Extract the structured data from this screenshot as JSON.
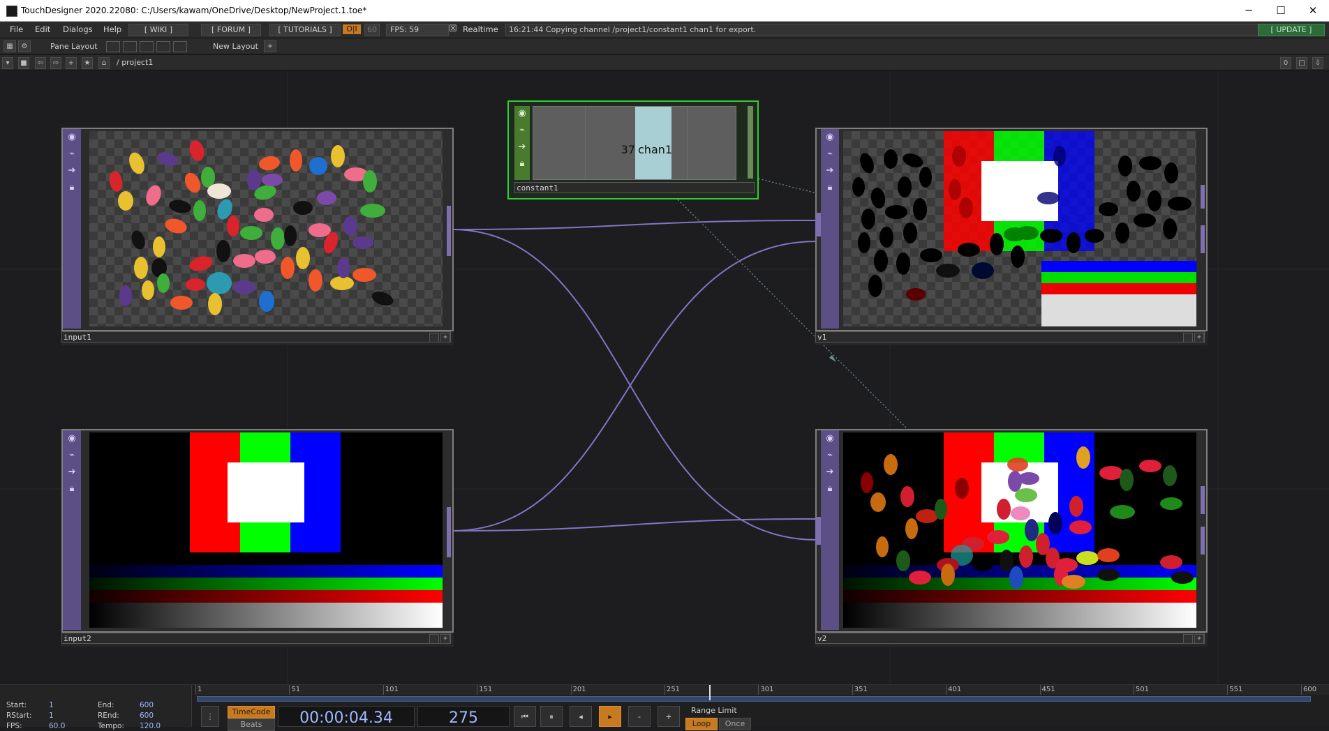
{
  "window": {
    "title": "TouchDesigner 2020.22080: C:/Users/kawam/OneDrive/Desktop/NewProject.1.toe*",
    "minimize": "─",
    "maximize": "☐",
    "close": "✕"
  },
  "menubar": {
    "items": [
      "File",
      "Edit",
      "Dialogs",
      "Help"
    ],
    "wiki": "[ WIKI ]",
    "forum": "[ FORUM ]",
    "tutorials": "[ TUTORIALS ]",
    "oi": "O|I",
    "fps_cap": "60",
    "fps": "FPS:  59",
    "realtime_check": "☒",
    "realtime": "Realtime",
    "status": "16:21:44 Copying channel /project1/constant1 chan1 for export.",
    "update": "[ UPDATE ]"
  },
  "layoutbar": {
    "pane_layout": "Pane Layout",
    "new_layout": "New Layout",
    "add": "+"
  },
  "pathbar": {
    "path": "/  project1",
    "zero": "0"
  },
  "nodes": {
    "input1": {
      "name": "input1"
    },
    "input2": {
      "name": "input2"
    },
    "v1": {
      "name": "v1"
    },
    "v2": {
      "name": "v2"
    },
    "constant1": {
      "name": "constant1",
      "value": "37",
      "channel": "chan1"
    }
  },
  "timeline": {
    "ticks": [
      "1",
      "51",
      "101",
      "151",
      "201",
      "251",
      "301",
      "351",
      "401",
      "451",
      "501",
      "551",
      "600"
    ],
    "start_label": "Start:",
    "start": "1",
    "end_label": "End:",
    "end": "600",
    "rstart_label": "RStart:",
    "rstart": "1",
    "rend_label": "REnd:",
    "rend": "600",
    "fps_label": "FPS:",
    "fps": "60.0",
    "tempo_label": "Tempo:",
    "tempo": "120.0",
    "timecode_btn": "TimeCode",
    "beats_btn": "Beats",
    "timecode": "00:00:04.34",
    "frame": "275",
    "range_limit": "Range Limit",
    "loop": "Loop",
    "once": "Once",
    "playhead_frame": 275
  },
  "colors": {
    "accent_orange": "#c87a20",
    "node_purple": "#5c4f86",
    "wire": "#8474c4",
    "selected_green": "#33cc33"
  }
}
